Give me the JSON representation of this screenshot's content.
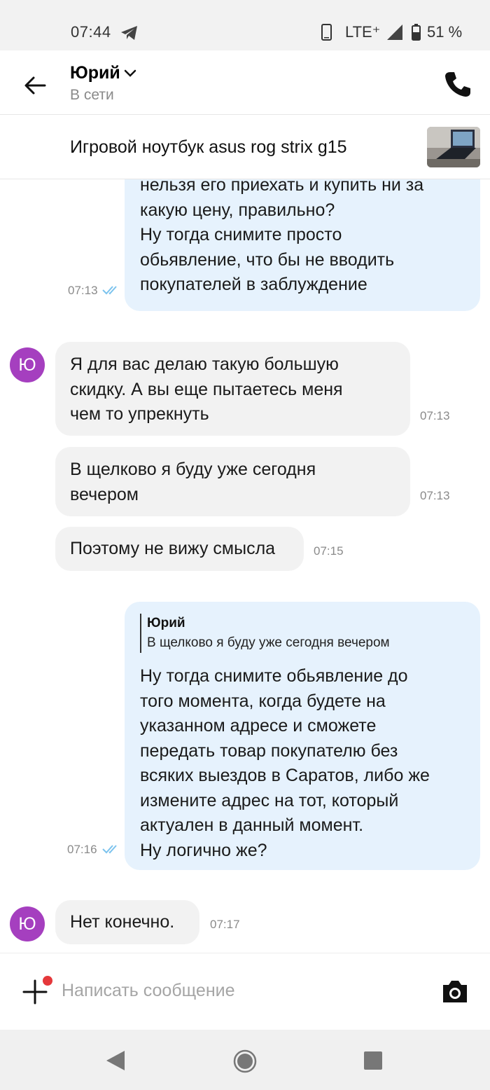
{
  "status_bar": {
    "time": "07:44",
    "network": "LTE⁺",
    "battery": "51 %",
    "icons": [
      "telegram-icon",
      "phone-icon",
      "signal-icon",
      "battery-icon"
    ]
  },
  "header": {
    "name": "Юрий",
    "status": "В сети"
  },
  "listing": {
    "title": "Игровой ноутбук asus rog strix g15"
  },
  "messages": [
    {
      "direction": "out",
      "text": "нельзя его приехать и купить ни за\nкакую цену, правильно?\nНу тогда снимите просто\nобьявление, что бы не вводить\nпокупателей в заблуждение",
      "time": "07:13",
      "read": true
    },
    {
      "direction": "in",
      "avatar": "Ю",
      "text": "Я для  вас делаю такую большую\nскидку. А вы еще пытаетесь меня\nчем то упрекнуть",
      "time": "07:13"
    },
    {
      "direction": "in",
      "text": "В щелково я буду уже сегодня\nвечером",
      "time": "07:13"
    },
    {
      "direction": "in",
      "text": "Поэтому не вижу смысла",
      "time": "07:15"
    },
    {
      "direction": "out",
      "quote": {
        "author": "Юрий",
        "text": "В щелково я буду уже сегодня вечером"
      },
      "text": "Ну тогда снимите обьявление до\nтого момента, когда будете на\nуказанном адресе и сможете\nпередать товар покупателю без\nвсяких выездов в Саратов, либо же\nизмените адрес на тот, который\nактуален в данный момент.\nНу логично же?",
      "time": "07:16",
      "read": true
    },
    {
      "direction": "in",
      "avatar": "Ю",
      "text": "Нет конечно.",
      "time": "07:17"
    }
  ],
  "composer": {
    "placeholder": "Написать сообщение",
    "has_notification_dot": true
  },
  "colors": {
    "outgoing_bubble": "#e6f2fd",
    "incoming_bubble": "#f2f2f2",
    "avatar": "#a53fbf",
    "read_ticks": "#7cc3ee",
    "notification_dot": "#e5383b"
  }
}
